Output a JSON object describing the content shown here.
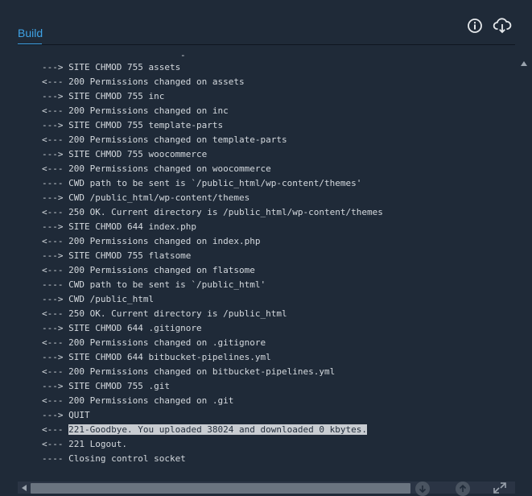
{
  "header": {
    "tab_label": "Build",
    "info_icon": "info-icon",
    "cloud_icon": "cloud-download-icon"
  },
  "log": {
    "top_fragment": "-",
    "lines": [
      "---> SITE CHMOD 755 assets",
      "<--- 200 Permissions changed on assets",
      "---> SITE CHMOD 755 inc",
      "<--- 200 Permissions changed on inc",
      "---> SITE CHMOD 755 template-parts",
      "<--- 200 Permissions changed on template-parts",
      "---> SITE CHMOD 755 woocommerce",
      "<--- 200 Permissions changed on woocommerce",
      "---- CWD path to be sent is `/public_html/wp-content/themes'",
      "---> CWD /public_html/wp-content/themes",
      "<--- 250 OK. Current directory is /public_html/wp-content/themes",
      "---> SITE CHMOD 644 index.php",
      "<--- 200 Permissions changed on index.php",
      "---> SITE CHMOD 755 flatsome",
      "<--- 200 Permissions changed on flatsome",
      "---- CWD path to be sent is `/public_html'",
      "---> CWD /public_html",
      "<--- 250 OK. Current directory is /public_html",
      "---> SITE CHMOD 644 .gitignore",
      "<--- 200 Permissions changed on .gitignore",
      "---> SITE CHMOD 644 bitbucket-pipelines.yml",
      "<--- 200 Permissions changed on bitbucket-pipelines.yml",
      "---> SITE CHMOD 755 .git",
      "<--- 200 Permissions changed on .git",
      "---> QUIT"
    ],
    "selected_prefix": "<--- ",
    "selected_text": "221-Goodbye. You uploaded 38024 and downloaded 0 kbytes.",
    "after_lines": [
      "<--- 221 Logout.",
      "---- Closing control socket"
    ]
  },
  "colors": {
    "background": "#1f2a38",
    "accent": "#3fa3e6",
    "text": "#d4d9de"
  }
}
